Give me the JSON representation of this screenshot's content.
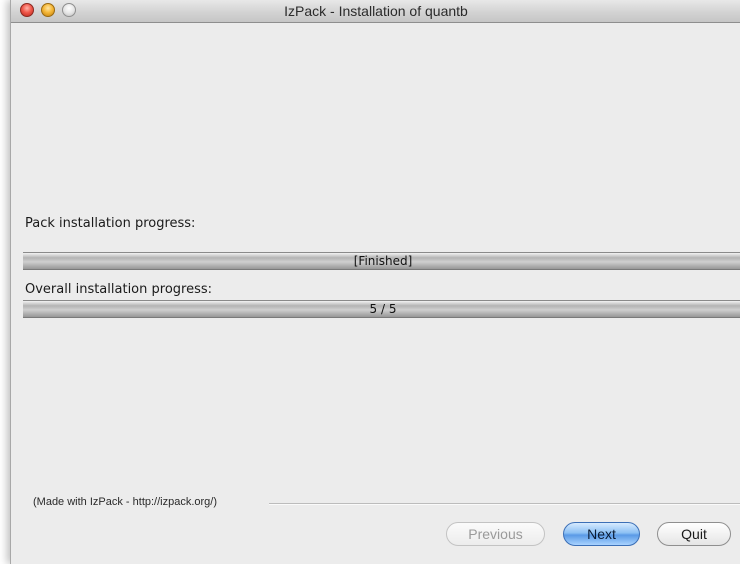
{
  "window": {
    "title": "IzPack - Installation of quantb"
  },
  "pack_progress": {
    "label": "Pack installation progress:",
    "status_text": "[Finished]",
    "fraction": 1.0
  },
  "overall_progress": {
    "label": "Overall installation progress:",
    "status_text": "5 / 5",
    "fraction": 1.0
  },
  "footer": {
    "credit": "(Made with IzPack - http://izpack.org/)"
  },
  "buttons": {
    "previous": "Previous",
    "next": "Next",
    "quit": "Quit"
  },
  "colors": {
    "close": "#f0594c",
    "minimize": "#f5b83a",
    "zoom": "#e6e6e6",
    "accent_button": "#5a9ae6"
  }
}
